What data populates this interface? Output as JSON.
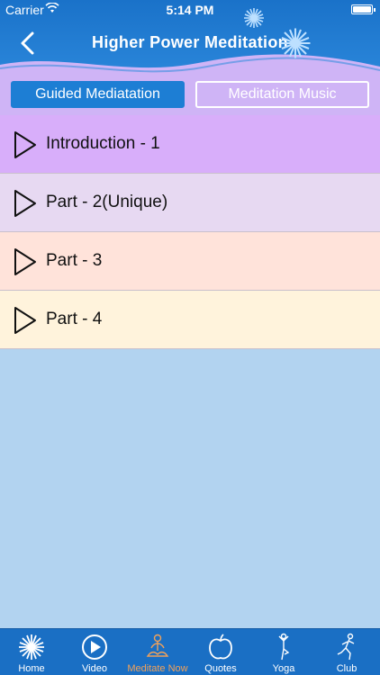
{
  "status_bar": {
    "carrier": "Carrier",
    "time": "5:14 PM"
  },
  "header": {
    "title": "Higher Power Meditation"
  },
  "tabs": [
    {
      "label": "Guided Mediatation",
      "selected": true
    },
    {
      "label": "Meditation Music",
      "selected": false
    }
  ],
  "tracks": [
    {
      "label": "Introduction - 1",
      "color": "#d8aefa"
    },
    {
      "label": "Part - 2(Unique)",
      "color": "#e7d9f2"
    },
    {
      "label": "Part - 3",
      "color": "#ffe3da"
    },
    {
      "label": "Part - 4",
      "color": "#fff3dc"
    }
  ],
  "tab_bar": {
    "items": [
      {
        "label": "Home",
        "icon": "sun-icon"
      },
      {
        "label": "Video",
        "icon": "play-circle-icon"
      },
      {
        "label": "Meditate Now",
        "icon": "meditation-pose-icon",
        "active": true
      },
      {
        "label": "Quotes",
        "icon": "apple-icon"
      },
      {
        "label": "Yoga",
        "icon": "yoga-pose-icon"
      },
      {
        "label": "Club",
        "icon": "running-figure-icon"
      }
    ]
  },
  "colors": {
    "header_blue": "#1a72c9",
    "tab_selected": "#1d7ed4",
    "active_tab_label": "#f0a15a",
    "background": "#b2d3f0"
  }
}
